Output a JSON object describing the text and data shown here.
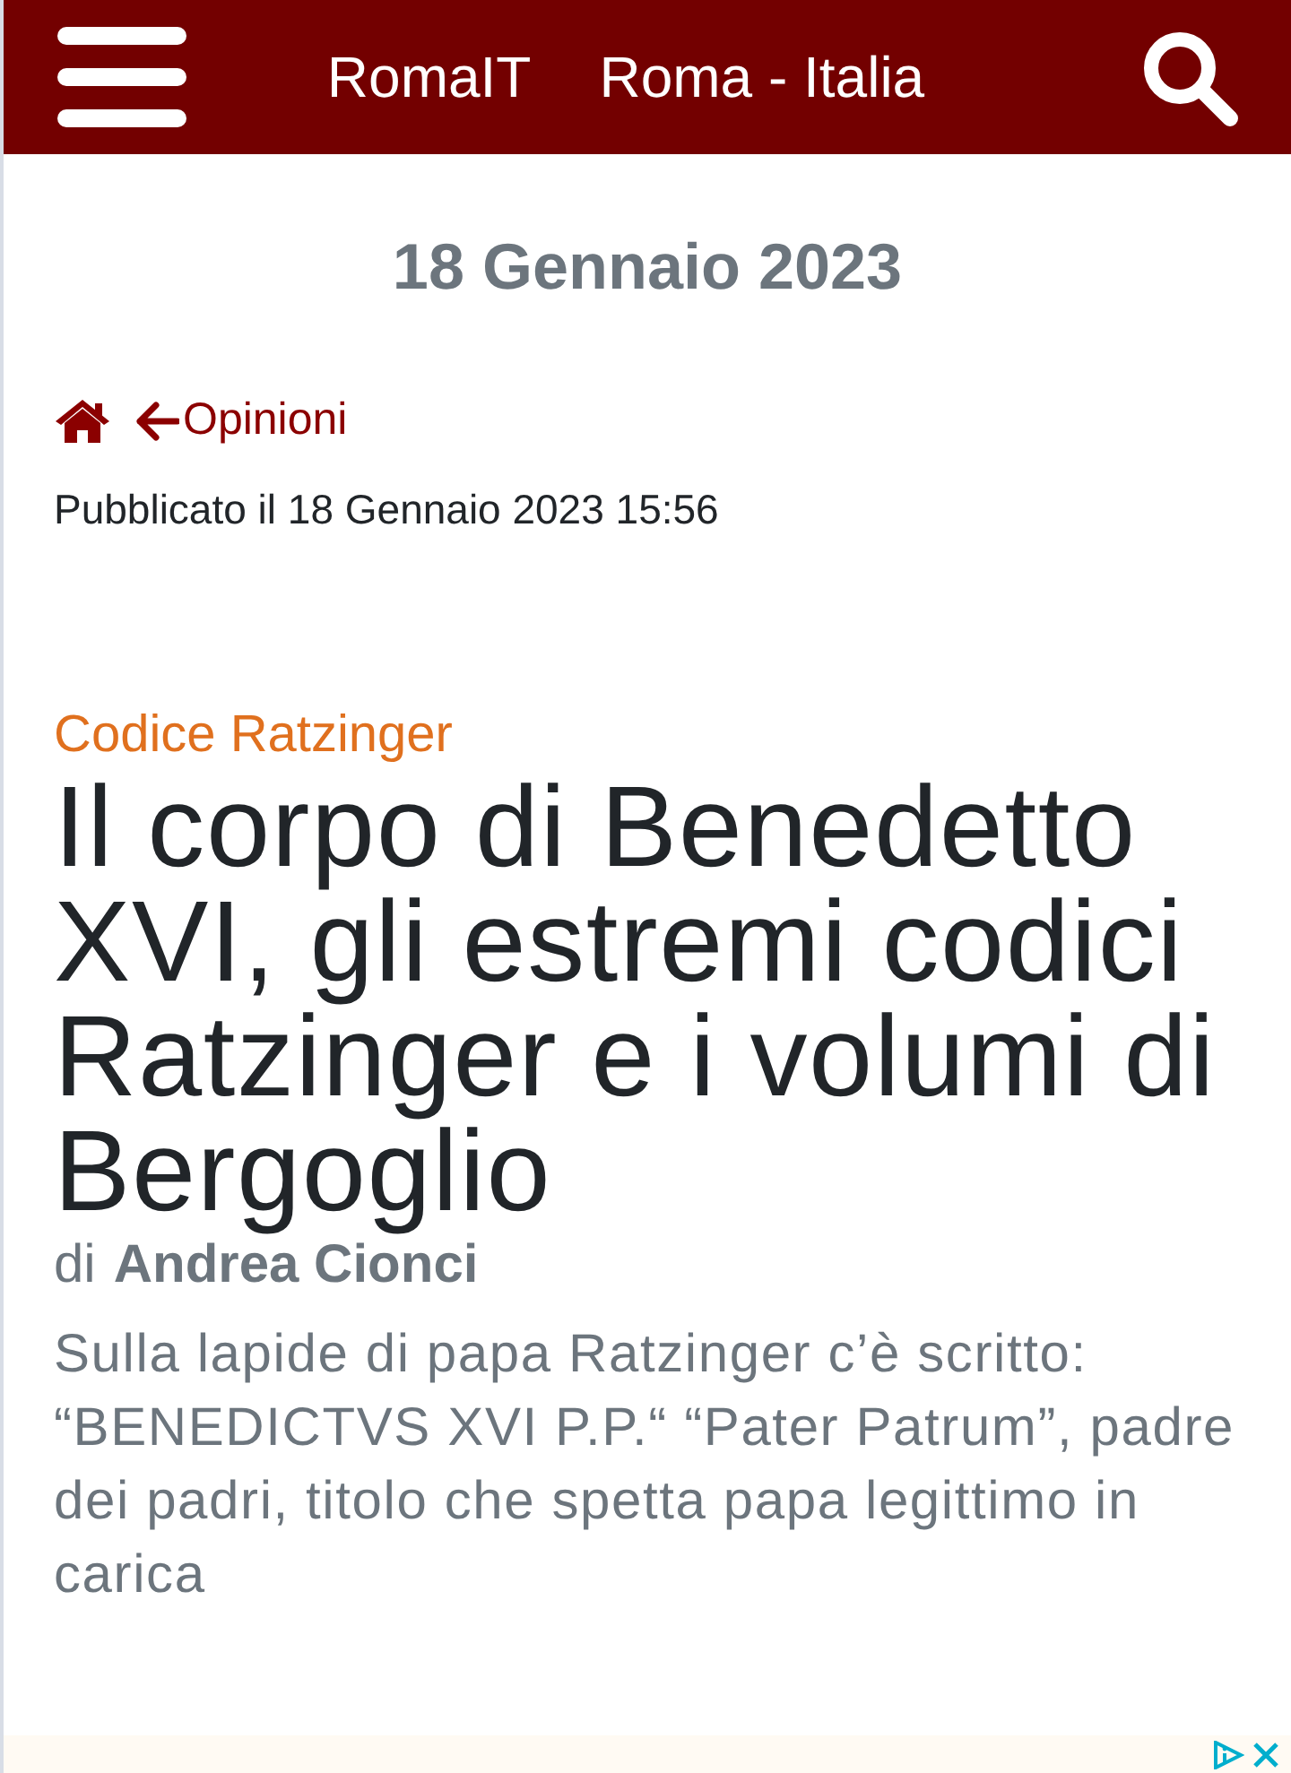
{
  "header": {
    "site_name": "RomaIT",
    "location": "Roma - Italia"
  },
  "date_heading": "18 Gennaio 2023",
  "breadcrumb": {
    "section": "Opinioni"
  },
  "published": "Pubblicato il 18 Gennaio 2023 15:56",
  "article": {
    "category": "Codice Ratzinger",
    "title": "Il corpo di Benedetto XVI, gli estremi codici Ratzinger e i volumi di Bergoglio",
    "author_prefix": "di",
    "author": "Andrea Cionci",
    "summary": "Sulla lapide di papa Ratzinger c’è scritto: “BENEDICTVS XVI P.P.“ “Pater Patrum”, padre dei padri, titolo che spetta papa legittimo in carica"
  }
}
